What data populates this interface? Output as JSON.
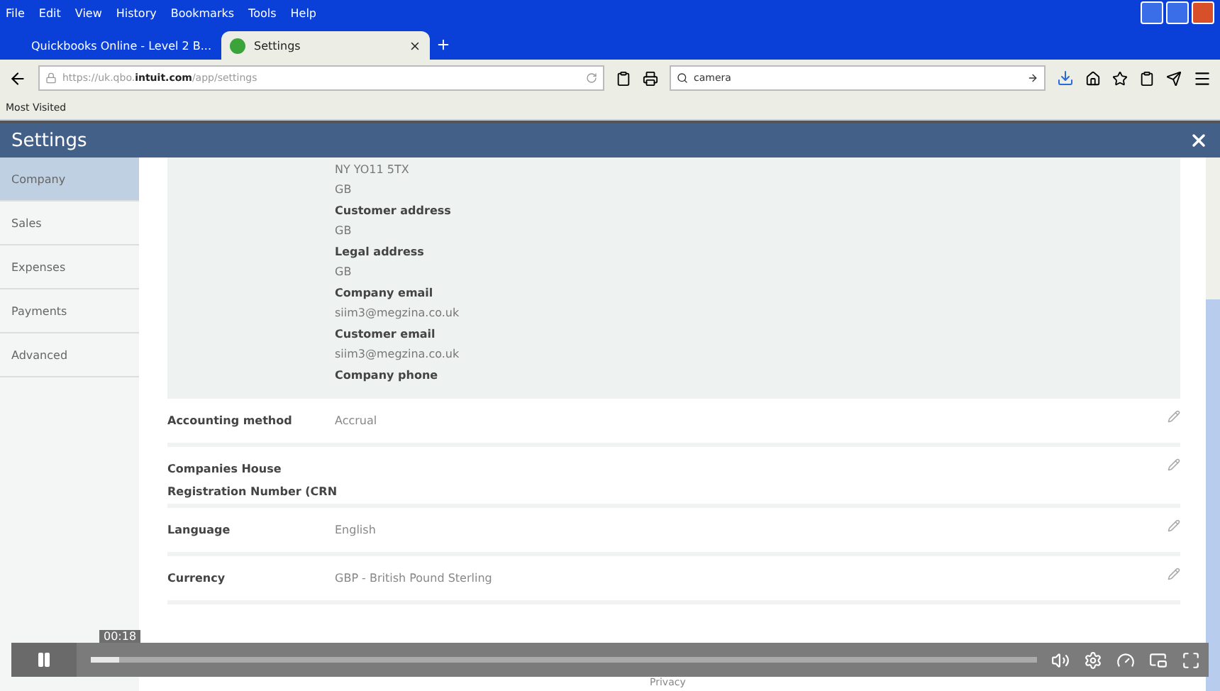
{
  "menu_bar": [
    "File",
    "Edit",
    "View",
    "History",
    "Bookmarks",
    "Tools",
    "Help"
  ],
  "tabs": [
    {
      "label": "Quickbooks Online - Level 2 B...",
      "selected": false
    },
    {
      "label": "Settings",
      "selected": true
    }
  ],
  "address": "https://uk.qbo.**intuit.com**/app/settings",
  "search": {
    "value": "camera"
  },
  "bookmarks": [
    "Most Visited"
  ],
  "dialog": {
    "title": "Settings"
  },
  "sidebar": [
    {
      "label": "Company",
      "selected": true
    },
    {
      "label": "Sales",
      "selected": false
    },
    {
      "label": "Expenses",
      "selected": false
    },
    {
      "label": "Payments",
      "selected": false
    },
    {
      "label": "Advanced",
      "selected": false
    }
  ],
  "company_block": [
    {
      "kind": "value",
      "text": "NY YO11 5TX"
    },
    {
      "kind": "value",
      "text": "GB"
    },
    {
      "kind": "label",
      "text": "Customer address"
    },
    {
      "kind": "value",
      "text": "GB"
    },
    {
      "kind": "label",
      "text": "Legal address"
    },
    {
      "kind": "value",
      "text": "GB"
    },
    {
      "kind": "label",
      "text": "Company email"
    },
    {
      "kind": "value",
      "text": "siim3@megzina.co.uk"
    },
    {
      "kind": "label",
      "text": "Customer email"
    },
    {
      "kind": "value",
      "text": "siim3@megzina.co.uk"
    },
    {
      "kind": "label",
      "text": "Company phone"
    }
  ],
  "rows": [
    {
      "label": "Accounting method",
      "value": "Accrual"
    },
    {
      "label": "Companies House\nRegistration Number (CRN"
    },
    {
      "label": "Language",
      "value": "English"
    },
    {
      "label": "Currency",
      "value": "GBP - British Pound Sterling"
    }
  ],
  "video": {
    "time": "00:18",
    "progress": {
      "level": 0.03
    }
  },
  "footer": "Privacy"
}
